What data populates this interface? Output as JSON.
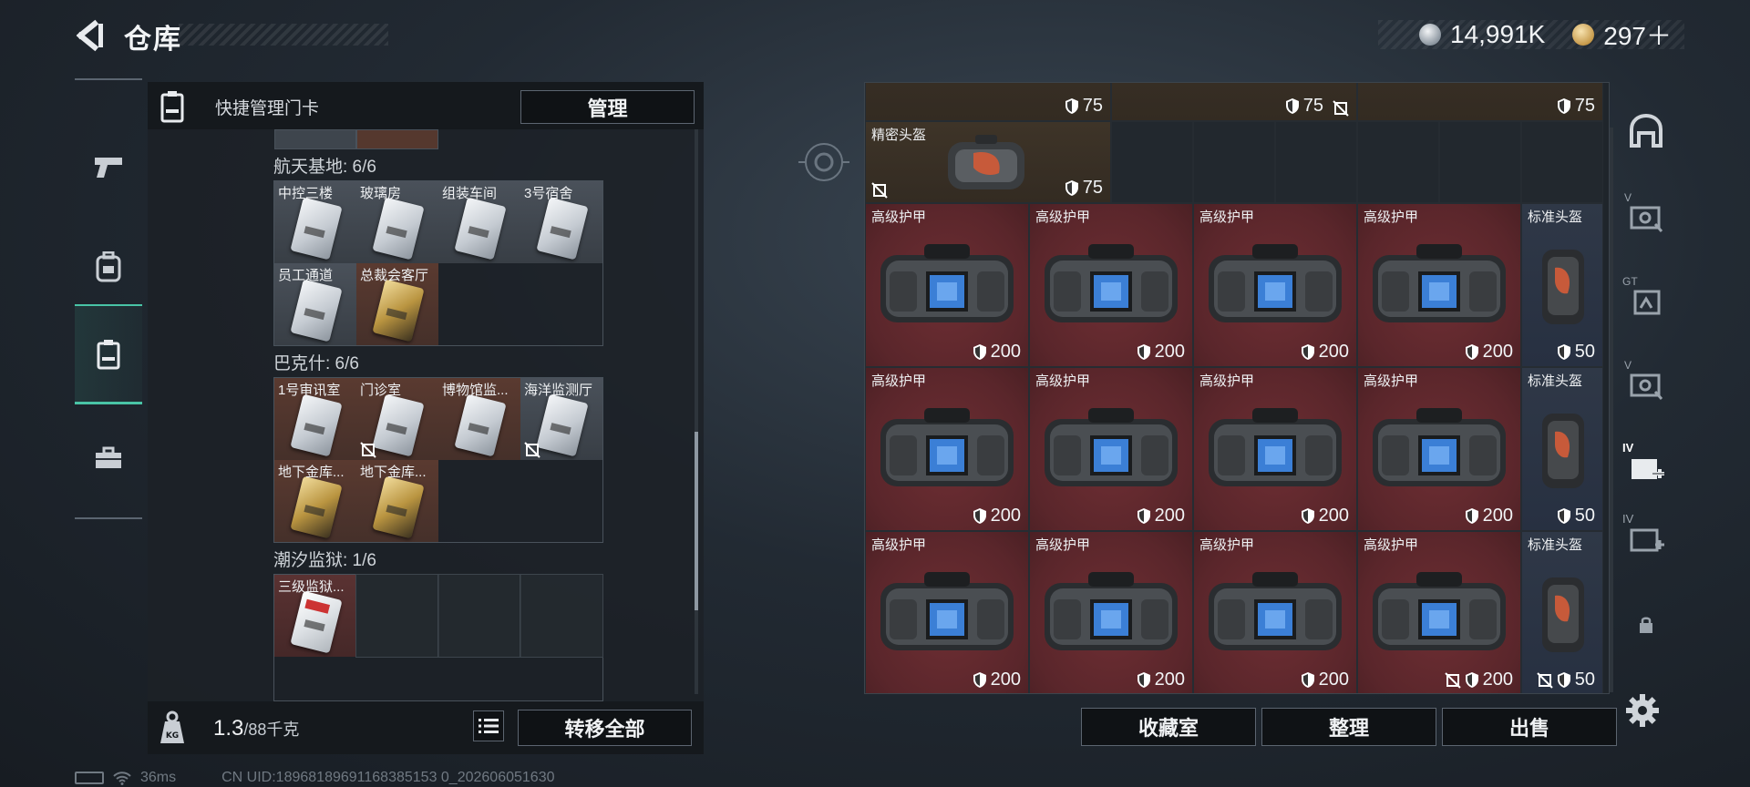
{
  "header": {
    "title": "仓库",
    "currency_primary": "14,991K",
    "currency_secondary": "297＋"
  },
  "left_panel": {
    "header_label": "快捷管理门卡",
    "manage_button": "管理",
    "groups": [
      {
        "title": "航天基地: 6/6",
        "cards": [
          {
            "label": "中控三楼",
            "style": "silver"
          },
          {
            "label": "玻璃房",
            "style": "silver"
          },
          {
            "label": "组装车间",
            "style": "silver"
          },
          {
            "label": "3号宿舍",
            "style": "silver"
          },
          {
            "label": "员工通道",
            "style": "silver"
          },
          {
            "label": "总裁会客厅",
            "style": "gold"
          }
        ]
      },
      {
        "title": "巴克什: 6/6",
        "cards": [
          {
            "label": "1号审讯室",
            "style": "silver"
          },
          {
            "label": "门诊室",
            "style": "silver"
          },
          {
            "label": "博物馆监...",
            "style": "silver"
          },
          {
            "label": "海洋监测厅",
            "style": "silver"
          },
          {
            "label": "地下金库...",
            "style": "gold"
          },
          {
            "label": "地下金库...",
            "style": "gold"
          }
        ]
      },
      {
        "title": "潮汐监狱: 1/6",
        "cards": [
          {
            "label": "三级监狱...",
            "style": "red"
          }
        ]
      }
    ],
    "weight_value": "1.3",
    "weight_capacity": "/88千克",
    "transfer_all_button": "转移全部"
  },
  "storage": {
    "top_row_durability": [
      "75",
      "75",
      "75"
    ],
    "row0": {
      "label": "精密头盔",
      "durability": "75"
    },
    "rows": [
      [
        {
          "label": "高级护甲",
          "durability": "200"
        },
        {
          "label": "高级护甲",
          "durability": "200"
        },
        {
          "label": "高级护甲",
          "durability": "200"
        },
        {
          "label": "高级护甲",
          "durability": "200"
        },
        {
          "label": "标准头盔",
          "durability": "50"
        }
      ],
      [
        {
          "label": "高级护甲",
          "durability": "200"
        },
        {
          "label": "高级护甲",
          "durability": "200"
        },
        {
          "label": "高级护甲",
          "durability": "200"
        },
        {
          "label": "高级护甲",
          "durability": "200"
        },
        {
          "label": "标准头盔",
          "durability": "50"
        }
      ],
      [
        {
          "label": "高级护甲",
          "durability": "200"
        },
        {
          "label": "高级护甲",
          "durability": "200"
        },
        {
          "label": "高级护甲",
          "durability": "200"
        },
        {
          "label": "高级护甲",
          "durability": "200"
        },
        {
          "label": "标准头盔",
          "durability": "50"
        }
      ]
    ],
    "buttons": {
      "collection": "收藏室",
      "organize": "整理",
      "sell": "出售"
    }
  },
  "right_rail": {
    "icons": [
      "helmet-icon",
      "case-v-icon",
      "case-gt-icon",
      "case-v2-icon",
      "case-iv-add-icon",
      "case-iv-add2-icon",
      "lock-icon"
    ],
    "labels": [
      "V",
      "GT",
      "V",
      "IV",
      "IV"
    ]
  },
  "status_bar": {
    "ping": "36ms",
    "uid": "CN UID:18968189691168385153 0_202606051630"
  },
  "colors": {
    "accent": "#49c4a6",
    "armor_bg": "#5a262b",
    "helmet_bg": "#2f3847"
  }
}
